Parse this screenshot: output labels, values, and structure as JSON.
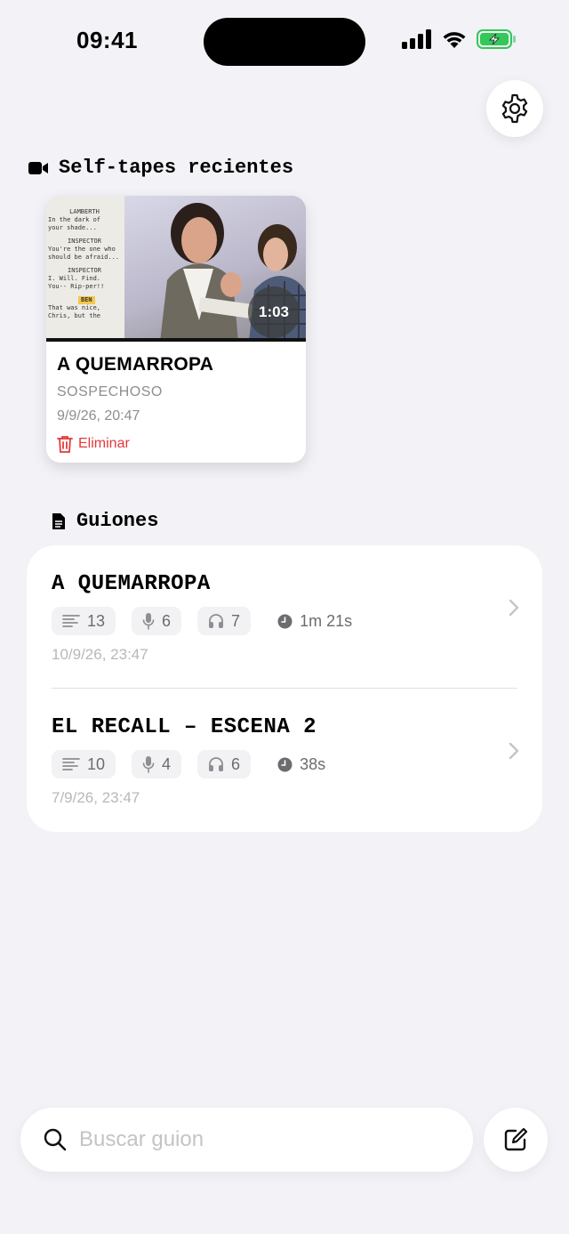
{
  "status_bar": {
    "time": "09:41"
  },
  "self_tapes": {
    "section_title": "Self-tapes recientes",
    "items": [
      {
        "title": "A QUEMARROPA",
        "role": "SOSPECHOSO",
        "date": "9/9/26, 20:47",
        "duration": "1:03",
        "delete_label": "Eliminar",
        "script_preview": [
          {
            "type": "character",
            "text": "LAMBERTH"
          },
          {
            "type": "line",
            "text": "In the dark of"
          },
          {
            "type": "line",
            "text": "your shade..."
          },
          {
            "type": "character",
            "text": "INSPECTOR"
          },
          {
            "type": "line",
            "text": "You're the one who"
          },
          {
            "type": "line",
            "text": "should be afraid..."
          },
          {
            "type": "character",
            "text": "INSPECTOR"
          },
          {
            "type": "line",
            "text": "I. Will. Find."
          },
          {
            "type": "line",
            "text": "You-- Rip-per!!"
          },
          {
            "type": "highlight",
            "text": "BEN"
          },
          {
            "type": "line",
            "text": "That was nice,"
          },
          {
            "type": "line",
            "text": "Chris, but the"
          }
        ]
      }
    ]
  },
  "scripts": {
    "section_title": "Guiones",
    "items": [
      {
        "title": "A QUEMARROPA",
        "lines": "13",
        "my_lines": "6",
        "listen_lines": "7",
        "duration": "1m 21s",
        "date": "10/9/26, 23:47"
      },
      {
        "title": "EL RECALL – ESCENA 2",
        "lines": "10",
        "my_lines": "4",
        "listen_lines": "6",
        "duration": "38s",
        "date": "7/9/26, 23:47"
      }
    ]
  },
  "search": {
    "placeholder": "Buscar guion",
    "value": ""
  },
  "colors": {
    "background": "#F2F2F7",
    "danger": "#E5383B",
    "battery": "#34C759",
    "muted": "#8E8E93"
  },
  "icons": [
    "settings-icon",
    "video-camera-icon",
    "document-icon",
    "trash-icon",
    "lines-icon",
    "microphone-icon",
    "headphones-icon",
    "clock-icon",
    "chevron-right-icon",
    "search-icon",
    "compose-icon",
    "play-icon"
  ]
}
